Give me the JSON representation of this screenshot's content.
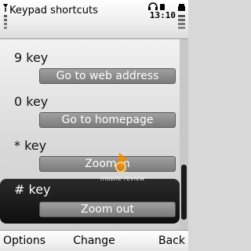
{
  "header": {
    "title": "Keypad shortcuts",
    "time": "13:10",
    "icons": [
      "signal-icon",
      "headset-icon",
      "keyboard-lock-icon",
      "battery-icon"
    ]
  },
  "shortcuts": [
    {
      "key": "9 key",
      "action": "Go to web address",
      "selected": false
    },
    {
      "key": "0 key",
      "action": "Go to homepage",
      "selected": false
    },
    {
      "key": "* key",
      "action": "Zoom in",
      "selected": false
    },
    {
      "key": "# key",
      "action": "Zoom out",
      "selected": true
    }
  ],
  "softkeys": {
    "left": "Options",
    "middle": "Change",
    "right": "Back"
  },
  "watermark": "mobile-review"
}
